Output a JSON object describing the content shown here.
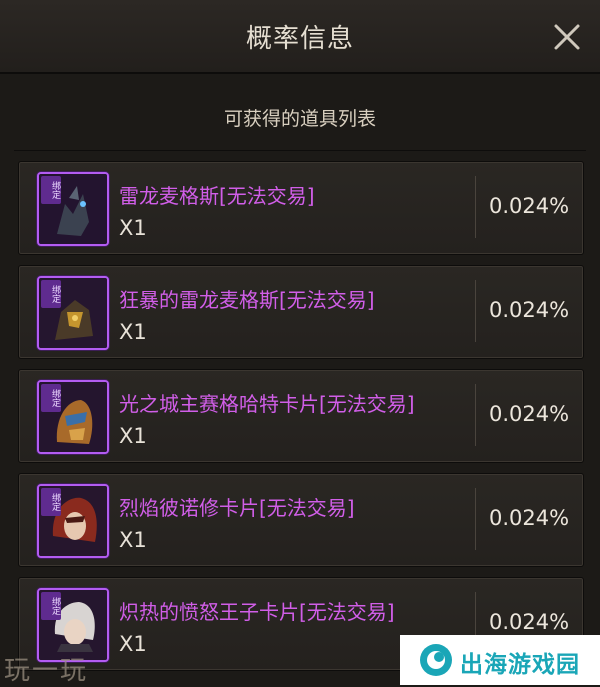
{
  "header": {
    "title": "概率信息"
  },
  "subtitle": "可获得的道具列表",
  "items": [
    {
      "badge": "绑定",
      "name": "雷龙麦格斯[无法交易]",
      "qty": "X1",
      "prob": "0.024%"
    },
    {
      "badge": "绑定",
      "name": "狂暴的雷龙麦格斯[无法交易]",
      "qty": "X1",
      "prob": "0.024%"
    },
    {
      "badge": "绑定",
      "name": "光之城主赛格哈特卡片[无法交易]",
      "qty": "X1",
      "prob": "0.024%"
    },
    {
      "badge": "绑定",
      "name": "烈焰彼诺修卡片[无法交易]",
      "qty": "X1",
      "prob": "0.024%"
    },
    {
      "badge": "绑定",
      "name": "炽热的愤怒王子卡片[无法交易]",
      "qty": "X1",
      "prob": "0.024%"
    }
  ],
  "watermarks": {
    "left": "玩一玩",
    "right": "出海游戏园"
  },
  "colors": {
    "item_name": "#d15ee8",
    "rarity_frame": "#b35cf2",
    "watermark": "#1aa6b7"
  }
}
